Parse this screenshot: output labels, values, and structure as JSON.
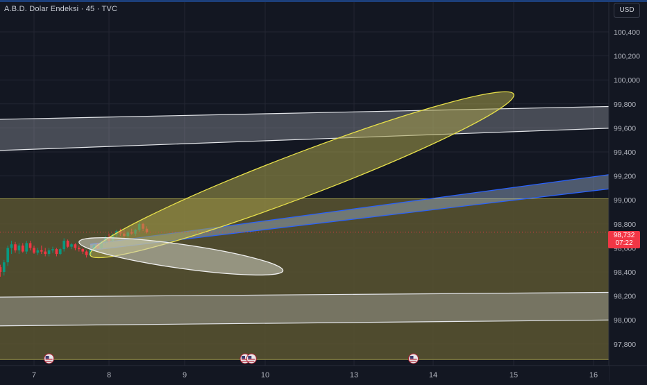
{
  "header": {
    "title": "A.B.D. Dolar Endeksi · 45 · TVC",
    "currency": "USD"
  },
  "last_price": {
    "value": "98,732",
    "countdown": "07:22"
  },
  "colors": {
    "background": "#131722",
    "grid": "#232632",
    "axis_text": "#b2b5be",
    "up_candle": "#089981",
    "down_candle": "#f23645",
    "price_tag": "#f23645",
    "yellow_zone": "#5a5530",
    "yellow_ellipse": "#e8e14a",
    "blue_channel": "#2962ff",
    "white_channel": "#d1d4dc"
  },
  "chart_data": {
    "type": "candlestick",
    "xlabel": "",
    "ylabel": "",
    "x_ticks": [
      {
        "label": "7",
        "day": 7
      },
      {
        "label": "8",
        "day": 8
      },
      {
        "label": "9",
        "day": 9
      },
      {
        "label": "10",
        "day": 10
      },
      {
        "label": "13",
        "day": 13
      },
      {
        "label": "14",
        "day": 14
      },
      {
        "label": "15",
        "day": 15
      },
      {
        "label": "16",
        "day": 16
      }
    ],
    "y_ticks": [
      {
        "label": "100,400",
        "value": 100.4
      },
      {
        "label": "100,200",
        "value": 100.2
      },
      {
        "label": "100,000",
        "value": 100.0
      },
      {
        "label": "99,800",
        "value": 99.8
      },
      {
        "label": "99,600",
        "value": 99.6
      },
      {
        "label": "99,400",
        "value": 99.4
      },
      {
        "label": "99,200",
        "value": 99.2
      },
      {
        "label": "99,000",
        "value": 99.0
      },
      {
        "label": "98,800",
        "value": 98.8
      },
      {
        "label": "98,600",
        "value": 98.6
      },
      {
        "label": "98,400",
        "value": 98.4
      },
      {
        "label": "98,200",
        "value": 98.2
      },
      {
        "label": "98,000",
        "value": 98.0
      },
      {
        "label": "97,800",
        "value": 97.8
      }
    ],
    "ylim": [
      97.67,
      100.62
    ],
    "grid": true,
    "candles": [
      {
        "x": 6.55,
        "open": 98.44,
        "high": 98.46,
        "low": 98.36,
        "close": 98.4
      },
      {
        "x": 6.6,
        "open": 98.4,
        "high": 98.5,
        "low": 98.37,
        "close": 98.48
      },
      {
        "x": 6.65,
        "open": 98.48,
        "high": 98.62,
        "low": 98.45,
        "close": 98.6
      },
      {
        "x": 6.7,
        "open": 98.6,
        "high": 98.66,
        "low": 98.55,
        "close": 98.63
      },
      {
        "x": 6.75,
        "open": 98.63,
        "high": 98.65,
        "low": 98.56,
        "close": 98.58
      },
      {
        "x": 6.8,
        "open": 98.58,
        "high": 98.64,
        "low": 98.55,
        "close": 98.62
      },
      {
        "x": 6.85,
        "open": 98.62,
        "high": 98.64,
        "low": 98.56,
        "close": 98.57
      },
      {
        "x": 6.9,
        "open": 98.57,
        "high": 98.66,
        "low": 98.55,
        "close": 98.64
      },
      {
        "x": 6.95,
        "open": 98.64,
        "high": 98.66,
        "low": 98.58,
        "close": 98.6
      },
      {
        "x": 7.0,
        "open": 98.6,
        "high": 98.62,
        "low": 98.55,
        "close": 98.56
      },
      {
        "x": 7.05,
        "open": 98.56,
        "high": 98.6,
        "low": 98.54,
        "close": 98.58
      },
      {
        "x": 7.1,
        "open": 98.58,
        "high": 98.62,
        "low": 98.55,
        "close": 98.57
      },
      {
        "x": 7.15,
        "open": 98.57,
        "high": 98.6,
        "low": 98.53,
        "close": 98.55
      },
      {
        "x": 7.2,
        "open": 98.55,
        "high": 98.6,
        "low": 98.53,
        "close": 98.58
      },
      {
        "x": 7.25,
        "open": 98.58,
        "high": 98.61,
        "low": 98.56,
        "close": 98.59
      },
      {
        "x": 7.3,
        "open": 98.59,
        "high": 98.6,
        "low": 98.53,
        "close": 98.55
      },
      {
        "x": 7.35,
        "open": 98.55,
        "high": 98.6,
        "low": 98.54,
        "close": 98.59
      },
      {
        "x": 7.4,
        "open": 98.59,
        "high": 98.68,
        "low": 98.57,
        "close": 98.66
      },
      {
        "x": 7.45,
        "open": 98.66,
        "high": 98.67,
        "low": 98.6,
        "close": 98.61
      },
      {
        "x": 7.5,
        "open": 98.61,
        "high": 98.64,
        "low": 98.59,
        "close": 98.63
      },
      {
        "x": 7.55,
        "open": 98.63,
        "high": 98.64,
        "low": 98.58,
        "close": 98.6
      },
      {
        "x": 7.6,
        "open": 98.6,
        "high": 98.62,
        "low": 98.57,
        "close": 98.59
      },
      {
        "x": 7.65,
        "open": 98.59,
        "high": 98.6,
        "low": 98.55,
        "close": 98.57
      },
      {
        "x": 7.7,
        "open": 98.57,
        "high": 98.58,
        "low": 98.52,
        "close": 98.54
      },
      {
        "x": 7.75,
        "open": 98.54,
        "high": 98.6,
        "low": 98.53,
        "close": 98.58
      },
      {
        "x": 7.8,
        "open": 98.58,
        "high": 98.63,
        "low": 98.57,
        "close": 98.62
      },
      {
        "x": 7.85,
        "open": 98.62,
        "high": 98.64,
        "low": 98.59,
        "close": 98.6
      },
      {
        "x": 7.9,
        "open": 98.6,
        "high": 98.66,
        "low": 98.59,
        "close": 98.65
      },
      {
        "x": 7.95,
        "open": 98.65,
        "high": 98.7,
        "low": 98.63,
        "close": 98.68
      },
      {
        "x": 8.0,
        "open": 98.68,
        "high": 98.72,
        "low": 98.64,
        "close": 98.66
      },
      {
        "x": 8.05,
        "open": 98.66,
        "high": 98.72,
        "low": 98.65,
        "close": 98.71
      },
      {
        "x": 8.1,
        "open": 98.71,
        "high": 98.75,
        "low": 98.69,
        "close": 98.74
      },
      {
        "x": 8.15,
        "open": 98.74,
        "high": 98.76,
        "low": 98.7,
        "close": 98.72
      },
      {
        "x": 8.2,
        "open": 98.72,
        "high": 98.75,
        "low": 98.68,
        "close": 98.7
      },
      {
        "x": 8.25,
        "open": 98.7,
        "high": 98.74,
        "low": 98.68,
        "close": 98.73
      },
      {
        "x": 8.3,
        "open": 98.73,
        "high": 98.76,
        "low": 98.71,
        "close": 98.72
      },
      {
        "x": 8.35,
        "open": 98.72,
        "high": 98.76,
        "low": 98.7,
        "close": 98.75
      },
      {
        "x": 8.4,
        "open": 98.75,
        "high": 98.82,
        "low": 98.73,
        "close": 98.8
      },
      {
        "x": 8.45,
        "open": 98.8,
        "high": 98.81,
        "low": 98.74,
        "close": 98.76
      },
      {
        "x": 8.5,
        "open": 98.76,
        "high": 98.78,
        "low": 98.72,
        "close": 98.73
      }
    ],
    "drawings": {
      "yellow_zone": {
        "y_top": 99.01,
        "y_bottom": 97.67,
        "x_from": 6.45,
        "x_to": 16.3
      },
      "white_channel_upper": {
        "top": [
          [
            6.45,
            99.67
          ],
          [
            16.3,
            99.78
          ]
        ],
        "bottom": [
          [
            6.45,
            99.41
          ],
          [
            16.3,
            99.6
          ]
        ]
      },
      "white_channel_lower": {
        "top": [
          [
            6.45,
            98.19
          ],
          [
            16.3,
            98.23
          ]
        ],
        "bottom": [
          [
            6.45,
            97.95
          ],
          [
            16.3,
            98.0
          ]
        ]
      },
      "blue_channel": {
        "top": [
          [
            7.75,
            98.63
          ],
          [
            16.3,
            99.22
          ]
        ],
        "bottom": [
          [
            7.75,
            98.58
          ],
          [
            16.3,
            99.1
          ]
        ]
      },
      "yellow_ellipse": {
        "from": [
          7.75,
          98.54
        ],
        "to": [
          15.0,
          99.88
        ],
        "thickness_days": 0.58
      },
      "white_ellipse": {
        "from": [
          7.6,
          98.65
        ],
        "to": [
          10.6,
          98.41
        ],
        "thickness_days": 0.32
      },
      "event_flags": [
        7.2,
        9.75,
        9.83,
        13.75
      ]
    }
  }
}
